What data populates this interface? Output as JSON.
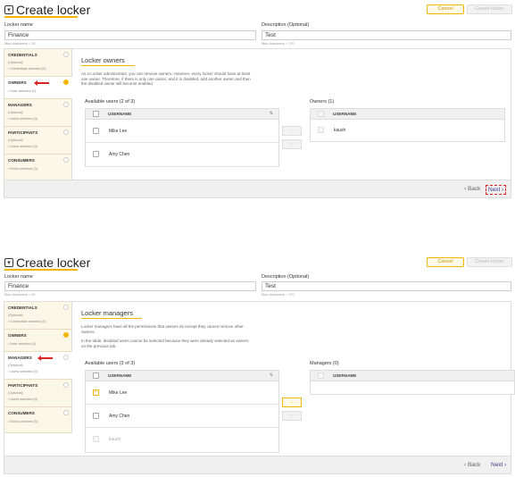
{
  "screens": [
    {
      "header": {
        "title": "Create locker",
        "cancel": "Cancel",
        "create": "Create locker"
      },
      "form": {
        "name_label": "Locker name",
        "name_value": "Finance",
        "name_hint": "Max characters = 30",
        "desc_label": "Description (Optional)",
        "desc_value": "Test",
        "desc_hint": "Max characters = 170"
      },
      "sidebar": [
        {
          "name": "CREDENTIALS",
          "sub1": "(Optional)",
          "sub2": "• Credentials selected (0)",
          "done": false
        },
        {
          "name": "OWNERS",
          "sub1": "• User selected (1)",
          "sub2": "",
          "done": true
        },
        {
          "name": "MANAGERS",
          "sub1": "(Optional)",
          "sub2": "• Users selected (0)",
          "done": false
        },
        {
          "name": "PARTICIPANTS",
          "sub1": "(Optional)",
          "sub2": "• Users selected (0)",
          "done": false
        },
        {
          "name": "CONSUMERS",
          "sub1": "• Roles selected (0)",
          "sub2": "",
          "done": false
        }
      ],
      "section": {
        "title": "Locker owners",
        "desc1": "As a Locker administrator, you can remove owners. However, every locker should have at least",
        "desc2": "one owner. Therefore, if there is only one owner, and it is disabled, add another owner and then",
        "desc3": "the disabled owner will become enabled."
      },
      "available": {
        "label": "Available users (2 of 3)",
        "header": "USERNAME",
        "sort": "⇅",
        "rows": [
          "Mike Lee",
          "Amy Chen"
        ]
      },
      "selected": {
        "label": "Owners (1)",
        "header": "USERNAME",
        "rows": [
          "kaush"
        ]
      },
      "move": {
        "right": "→",
        "left": "←"
      },
      "footer": {
        "back": "‹ Back",
        "next": "Next ›"
      }
    },
    {
      "header": {
        "title": "Create locker",
        "cancel": "Cancel",
        "create": "Create locker"
      },
      "form": {
        "name_label": "Locker name",
        "name_value": "Finance",
        "name_hint": "Max characters = 30",
        "desc_label": "Description (Optional)",
        "desc_value": "Test",
        "desc_hint": "Max characters = 170"
      },
      "sidebar": [
        {
          "name": "CREDENTIALS",
          "sub1": "(Optional)",
          "sub2": "• Credentials selected (0)",
          "done": false
        },
        {
          "name": "OWNERS",
          "sub1": "• User selected (1)",
          "sub2": "",
          "done": true
        },
        {
          "name": "MANAGERS",
          "sub1": "(Optional)",
          "sub2": "• Users selected (0)",
          "done": false
        },
        {
          "name": "PARTICIPANTS",
          "sub1": "(Optional)",
          "sub2": "• Users selected (0)",
          "done": false
        },
        {
          "name": "CONSUMERS",
          "sub1": "• Roles selected (0)",
          "sub2": "",
          "done": false
        }
      ],
      "section": {
        "title": "Locker managers",
        "desc1": "Locker managers have all the permissions that owners do except they cannot remove other",
        "desc2": "owners.",
        "desc3": "In the table, disabled users cannot be selected because they were already selected as owners",
        "desc4": "on the previous tab."
      },
      "available": {
        "label": "Available users (3 of 3)",
        "header": "USERNAME",
        "sort": "⇅",
        "rows": [
          "Mike Lee",
          "Amy Chen",
          "kaush"
        ],
        "checkmark": "✓"
      },
      "selected": {
        "label": "Managers (0)",
        "header": "USERNAME",
        "rows": []
      },
      "move": {
        "right": "→",
        "left": "←"
      },
      "footer": {
        "back": "‹ Back",
        "next": "Next ›"
      }
    }
  ],
  "colors": {
    "accent": "#f5b400",
    "sidebar_bg": "#fcf6e6",
    "callout_arrow": "#dd2222",
    "link": "#3a3a8a"
  }
}
